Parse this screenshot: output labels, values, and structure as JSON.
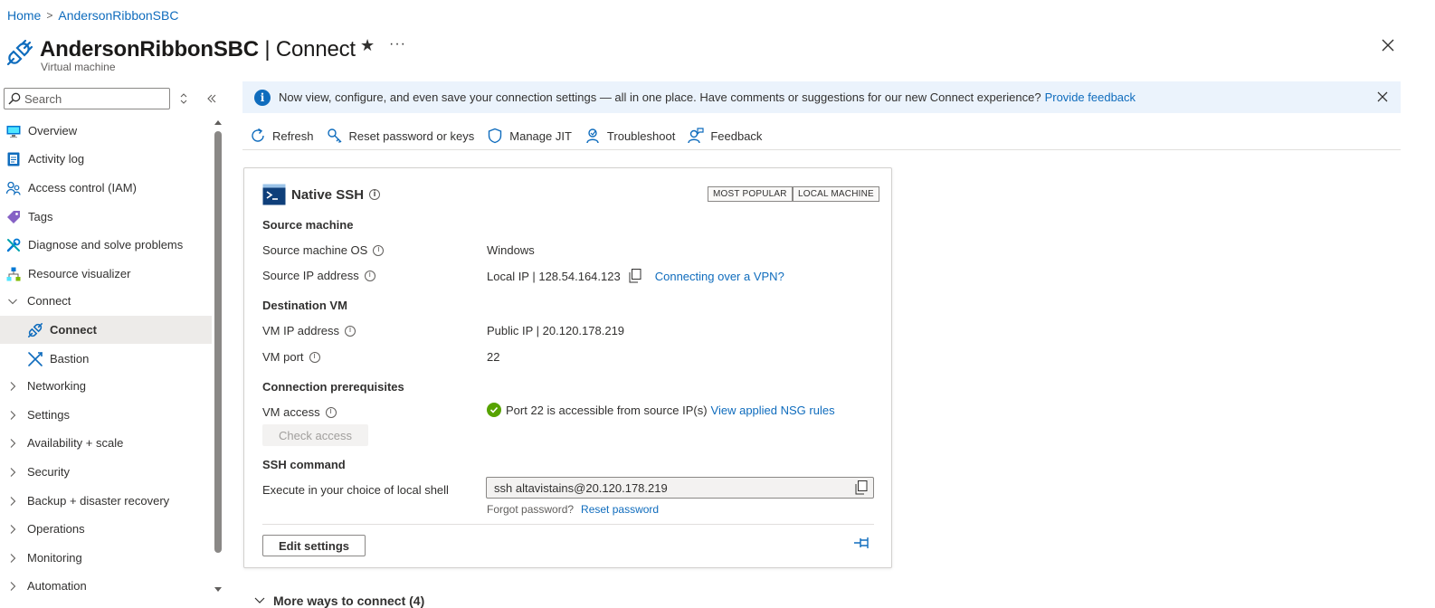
{
  "breadcrumb": {
    "home": "Home",
    "current": "AndersonRibbonSBC"
  },
  "header": {
    "title_name": "AndersonRibbonSBC",
    "title_sep": " | ",
    "title_page": "Connect",
    "subtitle": "Virtual machine",
    "star": "★",
    "more": "···"
  },
  "sidebar": {
    "search_placeholder": "Search",
    "items": [
      {
        "label": "Overview",
        "icon": "monitor-icon"
      },
      {
        "label": "Activity log",
        "icon": "activity-log-icon"
      },
      {
        "label": "Access control (IAM)",
        "icon": "people-icon"
      },
      {
        "label": "Tags",
        "icon": "tag-icon"
      },
      {
        "label": "Diagnose and solve problems",
        "icon": "wrench-icon"
      },
      {
        "label": "Resource visualizer",
        "icon": "hierarchy-icon"
      },
      {
        "label": "Connect",
        "icon": "chevron-down-icon",
        "expanded": true
      },
      {
        "label": "Connect",
        "icon": "plug-icon",
        "active": true
      },
      {
        "label": "Bastion",
        "icon": "bastion-icon"
      },
      {
        "label": "Networking",
        "icon": "chevron-right-icon"
      },
      {
        "label": "Settings",
        "icon": "chevron-right-icon"
      },
      {
        "label": "Availability + scale",
        "icon": "chevron-right-icon"
      },
      {
        "label": "Security",
        "icon": "chevron-right-icon"
      },
      {
        "label": "Backup + disaster recovery",
        "icon": "chevron-right-icon"
      },
      {
        "label": "Operations",
        "icon": "chevron-right-icon"
      },
      {
        "label": "Monitoring",
        "icon": "chevron-right-icon"
      },
      {
        "label": "Automation",
        "icon": "chevron-right-icon"
      }
    ]
  },
  "banner": {
    "text": "Now view, configure, and even save your connection settings — all in one place. Have comments or suggestions for our new Connect experience?",
    "link": "Provide feedback"
  },
  "toolbar": {
    "refresh": "Refresh",
    "reset": "Reset password or keys",
    "jit": "Manage JIT",
    "troubleshoot": "Troubleshoot",
    "feedback": "Feedback"
  },
  "card": {
    "title": "Native SSH",
    "badge_popular": "MOST POPULAR",
    "badge_local": "LOCAL MACHINE",
    "source_section": "Source machine",
    "source_os_label": "Source machine OS",
    "source_os_value": "Windows",
    "source_ip_label": "Source IP address",
    "source_ip_value": "Local IP | 128.54.164.123",
    "vpn_link": "Connecting over a VPN?",
    "dest_section": "Destination VM",
    "vm_ip_label": "VM IP address",
    "vm_ip_value": "Public IP | 20.120.178.219",
    "vm_port_label": "VM port",
    "vm_port_value": "22",
    "prereq_section": "Connection prerequisites",
    "vm_access_label": "VM access",
    "vm_access_value": "Port 22 is accessible from source IP(s)",
    "nsg_link": "View applied NSG rules",
    "check_access": "Check access",
    "ssh_section": "SSH command",
    "exec_label": "Execute in your choice of local shell",
    "ssh_command": "ssh altavistains@20.120.178.219",
    "forgot_text": "Forgot password?",
    "reset_link": "Reset password",
    "edit_settings": "Edit settings"
  },
  "more_ways": "More ways to connect (4)",
  "colors": {
    "accent": "#0f6cbd",
    "banner_bg": "#ebf3fc",
    "success": "#57a300"
  }
}
